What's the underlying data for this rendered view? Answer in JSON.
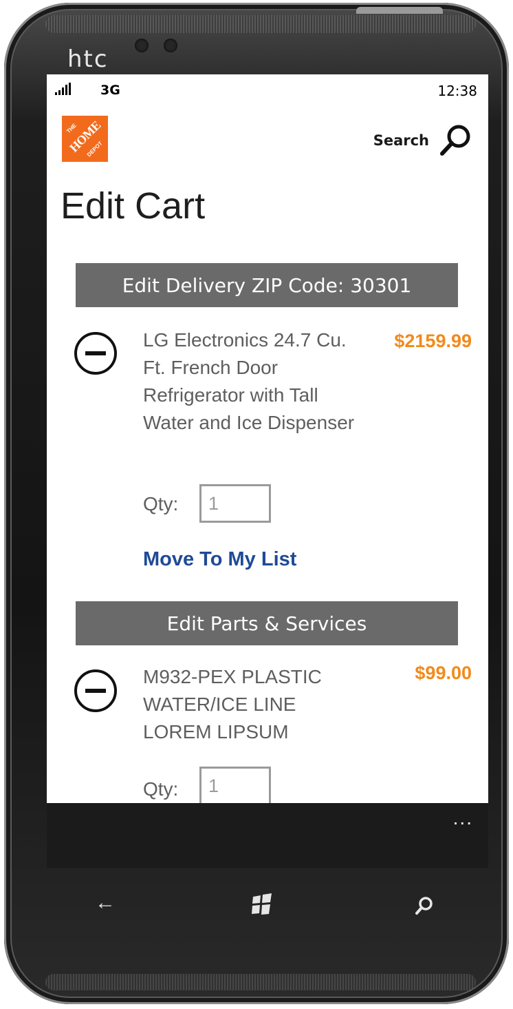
{
  "device": {
    "brand": "htc"
  },
  "status_bar": {
    "network": "3G",
    "time": "12:38"
  },
  "header": {
    "logo_text": "HOME",
    "logo_small_top": "THE",
    "logo_small_bottom": "DEPOT",
    "search_label": "Search"
  },
  "page": {
    "title": "Edit Cart"
  },
  "delivery_band": {
    "label": "Edit Delivery ZIP Code: 30301"
  },
  "cart_item": {
    "name": "LG Electronics 24.7 Cu. Ft. French Door Refrigerator with Tall Water and Ice Dispenser",
    "price": "$2159.99",
    "qty_label": "Qty:",
    "qty_value": "1",
    "move_label": "Move To My List"
  },
  "parts_band": {
    "label": "Edit Parts & Services"
  },
  "part_item": {
    "name": "M932-PEX PLASTIC WATER/ICE LINE LOREM LIPSUM",
    "price": "$99.00",
    "qty_label": "Qty:",
    "qty_value": "1"
  },
  "app_bar": {
    "more": "..."
  },
  "hardware_buttons": {
    "back_glyph": "←",
    "search_glyph": "⚲"
  },
  "colors": {
    "accent_orange": "#f28a1b",
    "link_blue": "#1f4a96",
    "band_gray": "#6a6a6a",
    "logo_orange": "#f26b1d"
  }
}
